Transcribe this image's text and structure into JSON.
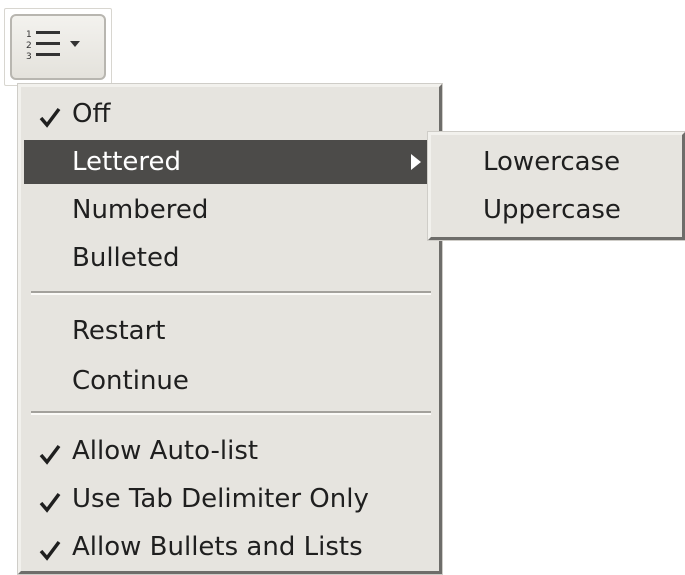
{
  "toolbar": {
    "list_button_icon": "numbered-list-icon"
  },
  "menu": {
    "items": [
      {
        "label": "Off",
        "checked": true
      },
      {
        "label": "Lettered",
        "checked": false,
        "submenu": true
      },
      {
        "label": "Numbered",
        "checked": false
      },
      {
        "label": "Bulleted",
        "checked": false
      },
      {
        "label": "Restart",
        "checked": false
      },
      {
        "label": "Continue",
        "checked": false
      },
      {
        "label": "Allow Auto-list",
        "checked": true
      },
      {
        "label": "Use Tab Delimiter Only",
        "checked": true
      },
      {
        "label": "Allow Bullets and Lists",
        "checked": true
      }
    ]
  },
  "submenu": {
    "items": [
      {
        "label": "Lowercase"
      },
      {
        "label": "Uppercase"
      }
    ]
  },
  "colors": {
    "menu_bg": "#e6e4df",
    "highlight_bg": "#4c4b49",
    "highlight_text": "#ffffff"
  }
}
